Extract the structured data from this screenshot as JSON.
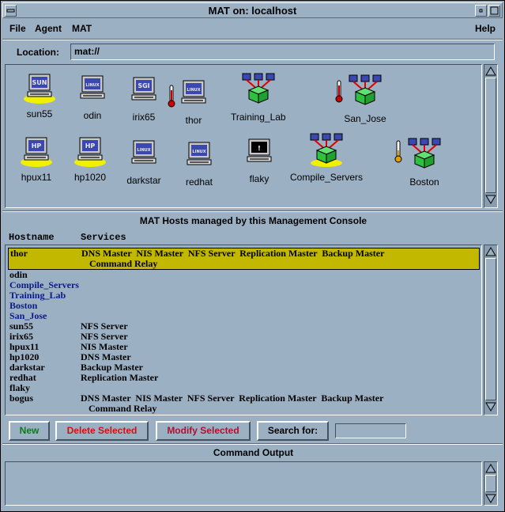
{
  "window": {
    "title": "MAT on: localhost"
  },
  "menubar": {
    "file": "File",
    "agent": "Agent",
    "mat": "MAT",
    "help": "Help"
  },
  "location": {
    "label": "Location:",
    "value": "mat://"
  },
  "hosts_icons": [
    {
      "name": "sun55",
      "kind": "sun",
      "badge": "SUN"
    },
    {
      "name": "odin",
      "kind": "linux",
      "badge": "LINUX"
    },
    {
      "name": "irix65",
      "kind": "sgi",
      "badge": "SGI"
    },
    {
      "name": "thor",
      "kind": "linux",
      "badge": "LINUX"
    },
    {
      "name": "Training_Lab",
      "kind": "group"
    },
    {
      "name": "San_Jose",
      "kind": "group"
    },
    {
      "name": "hpux11",
      "kind": "hp",
      "badge": "HP"
    },
    {
      "name": "hp1020",
      "kind": "hp",
      "badge": "HP"
    },
    {
      "name": "darkstar",
      "kind": "linux",
      "badge": "LINUX"
    },
    {
      "name": "redhat",
      "kind": "linux",
      "badge": "LINUX"
    },
    {
      "name": "flaky",
      "kind": "alert",
      "badge": "!"
    },
    {
      "name": "Compile_Servers",
      "kind": "group"
    },
    {
      "name": "Boston",
      "kind": "group"
    }
  ],
  "hosts_section": {
    "title": "MAT Hosts managed by this Management Console",
    "col_hostname": "Hostname",
    "col_services": "Services"
  },
  "hosts_rows": [
    {
      "host": "thor",
      "services": "DNS Master  NIS Master  NFS Server  Replication Master  Backup Master",
      "services2": "Command Relay"
    },
    {
      "host": "odin",
      "services": ""
    },
    {
      "host": "Compile_Servers",
      "services": ""
    },
    {
      "host": "Training_Lab",
      "services": ""
    },
    {
      "host": "Boston",
      "services": ""
    },
    {
      "host": "San_Jose",
      "services": ""
    },
    {
      "host": "sun55",
      "services": "NFS Server"
    },
    {
      "host": "irix65",
      "services": "NFS Server"
    },
    {
      "host": "hpux11",
      "services": "NIS Master"
    },
    {
      "host": "hp1020",
      "services": "DNS Master"
    },
    {
      "host": "darkstar",
      "services": "Backup Master"
    },
    {
      "host": "redhat",
      "services": "Replication Master"
    },
    {
      "host": "flaky",
      "services": ""
    },
    {
      "host": "bogus",
      "services": "DNS Master  NIS Master  NFS Server  Replication Master  Backup Master",
      "services2": "Command Relay"
    }
  ],
  "buttons": {
    "new": "New",
    "delete": "Delete Selected",
    "modify": "Modify Selected",
    "search_label": "Search for:"
  },
  "search": {
    "value": ""
  },
  "output": {
    "title": "Command Output"
  },
  "colors": {
    "selection": "#c2b800",
    "group_text": "#0a1a8a",
    "new_btn": "#0a7a1a",
    "delete_btn": "#d01010",
    "modify_btn": "#b01030",
    "halo": "#f0f000",
    "group_box": "#30c040"
  }
}
